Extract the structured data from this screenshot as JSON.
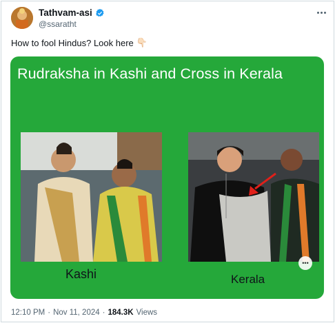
{
  "author": {
    "display_name": "Tathvam-asi",
    "handle": "@ssaratht",
    "verified_icon": "verified-badge-icon",
    "verified_color": "#1d9bf0"
  },
  "tweet": {
    "text": "How to fool Hindus? Look here",
    "emoji": "👇🏻"
  },
  "media": {
    "title": "Rudraksha in Kashi and Cross in Kerala",
    "background_color": "#25a83a",
    "left_caption": "Kashi",
    "right_caption": "Kerala"
  },
  "meta": {
    "time": "12:10 PM",
    "separator": "·",
    "date": "Nov 11, 2024",
    "views_count": "184.3K",
    "views_label": "Views"
  }
}
